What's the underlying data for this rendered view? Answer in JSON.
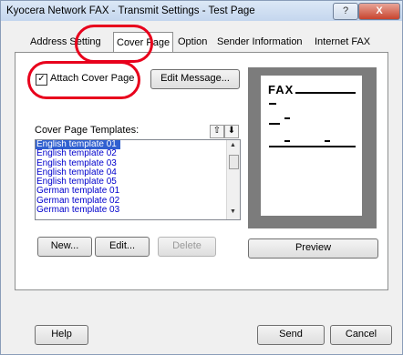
{
  "window": {
    "title": "Kyocera Network FAX - Transmit Settings - Test Page",
    "help_glyph": "?",
    "close_glyph": "X"
  },
  "tabs": [
    {
      "label": "Address Setting"
    },
    {
      "label": "Cover Page"
    },
    {
      "label": "Option"
    },
    {
      "label": "Sender Information"
    },
    {
      "label": "Internet FAX"
    }
  ],
  "attach_cover": {
    "label": "Attach Cover Page",
    "checked": true,
    "mark": "✓"
  },
  "edit_message_label": "Edit Message...",
  "templates": {
    "label": "Cover Page Templates:",
    "move_up": "⇧",
    "move_down": "⬇",
    "items": [
      "English template 01",
      "English template 02",
      "English template 03",
      "English template 04",
      "English template 05",
      "German template 01",
      "German template 02",
      "German template 03"
    ],
    "selected": "English template 01"
  },
  "buttons": {
    "new": "New...",
    "edit": "Edit...",
    "delete": "Delete",
    "preview": "Preview",
    "help": "Help",
    "send": "Send",
    "cancel": "Cancel"
  },
  "preview": {
    "fax_heading": "FAX"
  },
  "colors": {
    "annotation": "#e8001c",
    "selection": "#3060d0",
    "list_text": "#0000cc"
  }
}
